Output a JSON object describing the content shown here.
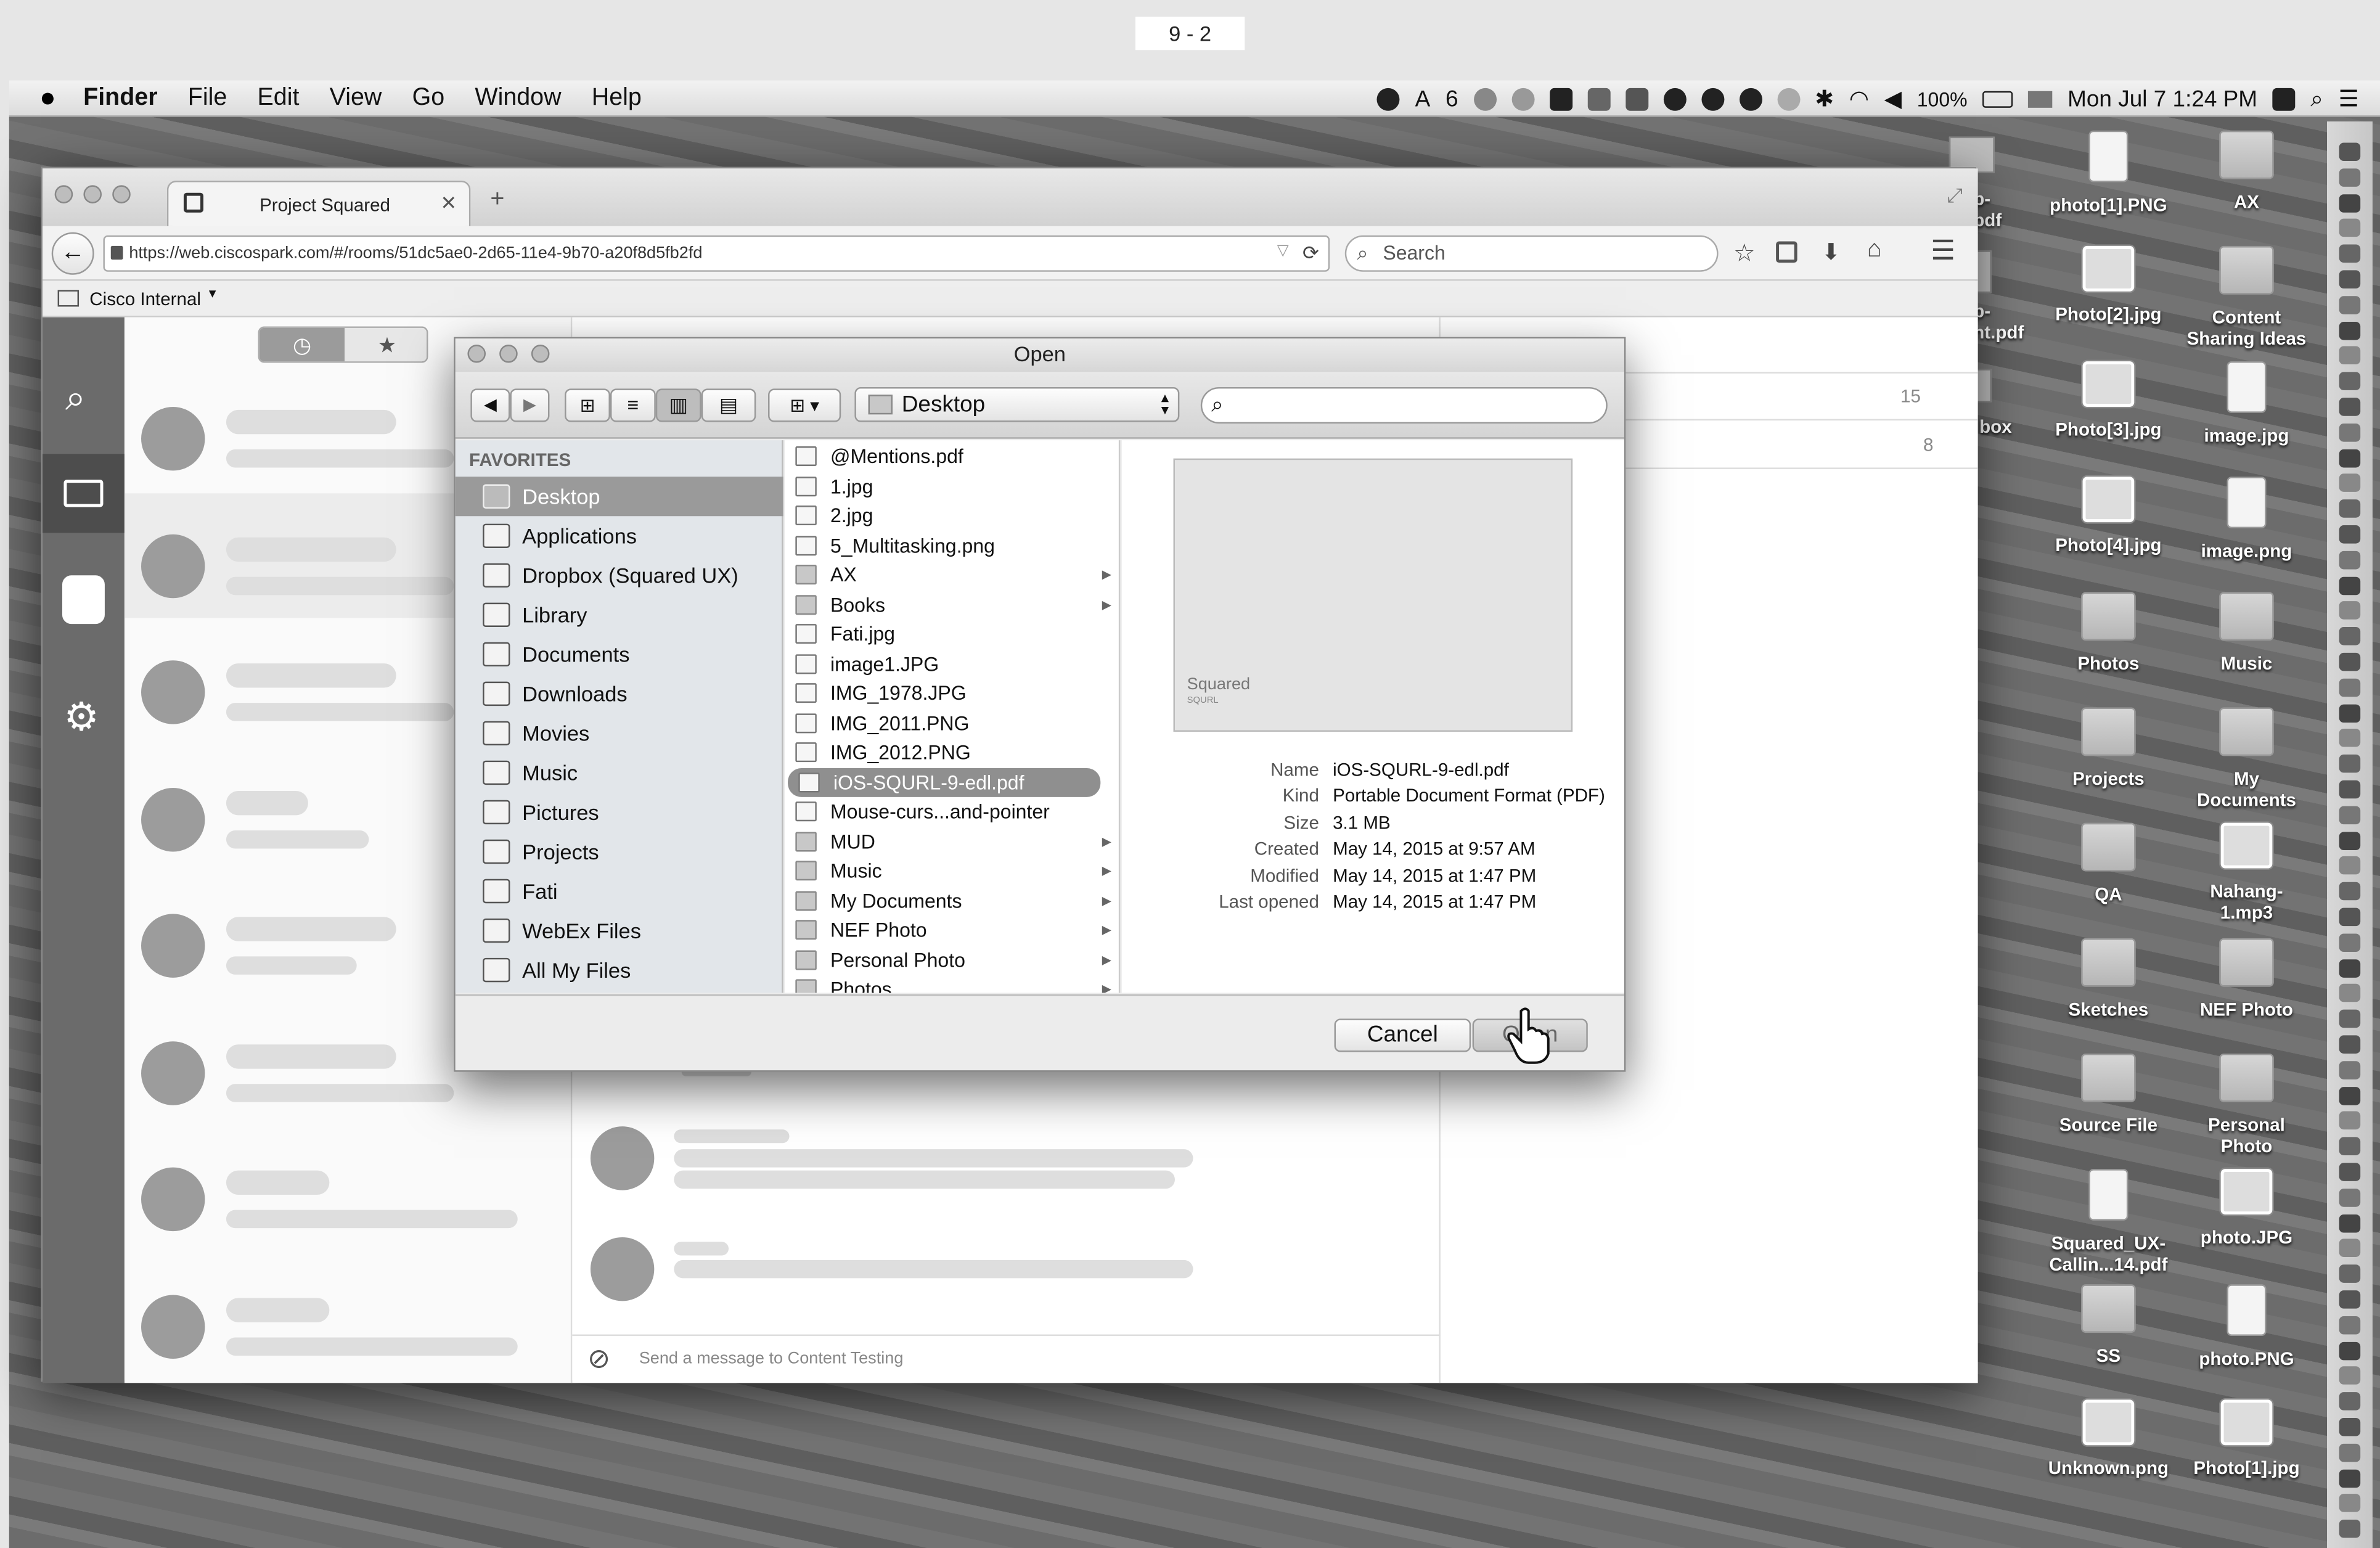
{
  "page_label": "9 - 2",
  "menubar": {
    "app": "Finder",
    "items": [
      "File",
      "Edit",
      "View",
      "Go",
      "Window",
      "Help"
    ],
    "status": {
      "notif": "6",
      "battery": "100%",
      "datetime": "Mon Jul 7  1:24 PM"
    }
  },
  "desktop_icons": [
    {
      "label": "photo[1].PNG",
      "type": "file"
    },
    {
      "label": "AX",
      "type": "folder"
    },
    {
      "label": "Photo[2].jpg",
      "type": "img"
    },
    {
      "label": "Content Sharing Ideas",
      "type": "folder"
    },
    {
      "label": "Photo[3].jpg",
      "type": "img"
    },
    {
      "label": "image.jpg",
      "type": "file"
    },
    {
      "label": "Photo[4].jpg",
      "type": "img"
    },
    {
      "label": "image.png",
      "type": "file"
    },
    {
      "label": "Photos",
      "type": "folder"
    },
    {
      "label": "Music",
      "type": "folder"
    },
    {
      "label": "Projects",
      "type": "folder"
    },
    {
      "label": "My Documents",
      "type": "folder"
    },
    {
      "label": "QA",
      "type": "folder"
    },
    {
      "label": "Nahang-1.mp3",
      "type": "img"
    },
    {
      "label": "Sketches",
      "type": "folder"
    },
    {
      "label": "NEF Photo",
      "type": "folder"
    },
    {
      "label": "Source File",
      "type": "folder"
    },
    {
      "label": "Personal Photo",
      "type": "folder"
    },
    {
      "label": "Squared_UX-Callin...14.pdf",
      "type": "file"
    },
    {
      "label": "photo.JPG",
      "type": "img"
    },
    {
      "label": "SS",
      "type": "folder"
    },
    {
      "label": "photo.PNG",
      "type": "file"
    },
    {
      "label": "Unknown.png",
      "type": "img"
    },
    {
      "label": "Photo[1].jpg",
      "type": "img"
    }
  ],
  "partial_icons": [
    "p-\npdf",
    "p-\nnt.pdf",
    "box"
  ],
  "browser": {
    "tab_title": "Project Squared",
    "url": "https://web.ciscospark.com/#/rooms/51dc5ae0-2d65-11e4-9b70-a20f8d5fb2fd",
    "search_placeholder": "Search",
    "bookmark": "Cisco Internal",
    "counts": [
      "15",
      "8"
    ],
    "composer_placeholder": "Send a message to Content Testing"
  },
  "dialog": {
    "title": "Open",
    "location": "Desktop",
    "favorites_header": "FAVORITES",
    "favorites": [
      "Desktop",
      "Applications",
      "Dropbox (Squared UX)",
      "Library",
      "Documents",
      "Downloads",
      "Movies",
      "Music",
      "Pictures",
      "Projects",
      "Fati",
      "WebEx Files",
      "All My Files"
    ],
    "files": [
      {
        "name": "@Mentions.pdf",
        "folder": false
      },
      {
        "name": "1.jpg",
        "folder": false
      },
      {
        "name": "2.jpg",
        "folder": false
      },
      {
        "name": "5_Multitasking.png",
        "folder": false
      },
      {
        "name": "AX",
        "folder": true
      },
      {
        "name": "Books",
        "folder": true
      },
      {
        "name": "Fati.jpg",
        "folder": false
      },
      {
        "name": "image1.JPG",
        "folder": false
      },
      {
        "name": "IMG_1978.JPG",
        "folder": false
      },
      {
        "name": "IMG_2011.PNG",
        "folder": false
      },
      {
        "name": "IMG_2012.PNG",
        "folder": false
      },
      {
        "name": "iOS-SQURL-9-edl.pdf",
        "folder": false,
        "selected": true
      },
      {
        "name": "Mouse-curs...and-pointer",
        "folder": false
      },
      {
        "name": "MUD",
        "folder": true
      },
      {
        "name": "Music",
        "folder": true
      },
      {
        "name": "My Documents",
        "folder": true
      },
      {
        "name": "NEF Photo",
        "folder": true
      },
      {
        "name": "Personal Photo",
        "folder": true
      },
      {
        "name": "Photos",
        "folder": true
      }
    ],
    "preview": {
      "thumb_text": "Squared",
      "thumb_sub": "SQURL",
      "info": [
        {
          "k": "Name",
          "v": "iOS-SQURL-9-edl.pdf"
        },
        {
          "k": "Kind",
          "v": "Portable Document Format (PDF)"
        },
        {
          "k": "Size",
          "v": "3.1 MB"
        },
        {
          "k": "Created",
          "v": "May 14, 2015 at 9:57 AM"
        },
        {
          "k": "Modified",
          "v": "May 14, 2015 at 1:47 PM"
        },
        {
          "k": "Last opened",
          "v": "May 14, 2015 at 1:47 PM"
        }
      ]
    },
    "cancel_label": "Cancel",
    "open_label": "Open"
  }
}
